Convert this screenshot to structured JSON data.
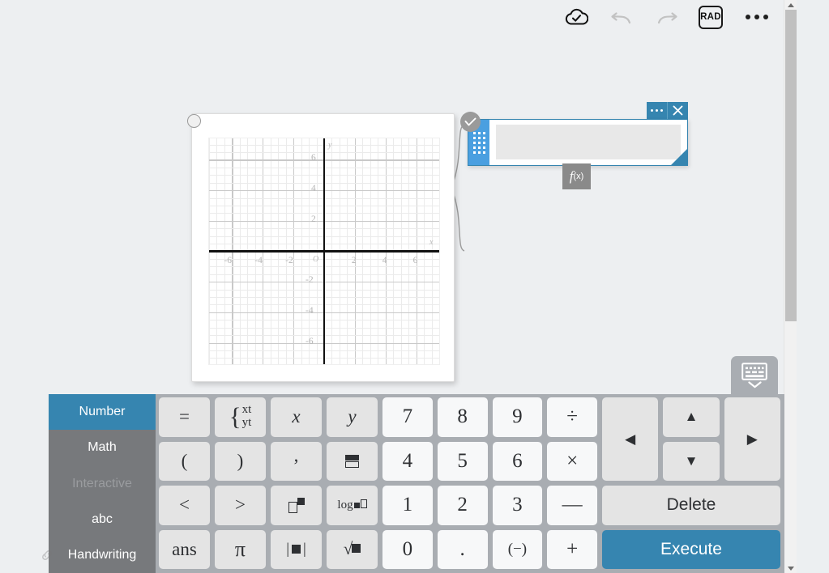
{
  "toolbar": {
    "cloud_label": "cloud-saved",
    "undo_label": "undo",
    "redo_label": "redo",
    "angle_mode": "RAD",
    "more_label": "more-options"
  },
  "graph": {
    "x_axis_name": "x",
    "y_axis_name": "y",
    "origin_label": "O",
    "x_ticks": [
      "-6",
      "-4",
      "-2",
      "2",
      "4",
      "6"
    ],
    "y_ticks": [
      "6",
      "4",
      "2",
      "-2",
      "-4",
      "-6"
    ]
  },
  "chart_data": {
    "type": "scatter",
    "title": "",
    "xlabel": "x",
    "ylabel": "y",
    "xlim": [
      -7.5,
      7.5
    ],
    "ylim": [
      -7.4,
      7.4
    ],
    "xticks": [
      -6,
      -4,
      -2,
      2,
      4,
      6
    ],
    "yticks": [
      6,
      4,
      2,
      -2,
      -4,
      -6
    ],
    "grid": true,
    "minor_grid_step": 0.5,
    "major_grid_step": 2,
    "legend": "none",
    "series": []
  },
  "input_panel": {
    "value": "",
    "placeholder": "",
    "confirm_label": "confirm",
    "more_label": "panel-menu",
    "close_label": "close",
    "grip_label": "drag-handle",
    "resize_label": "resize",
    "fx_label": "f",
    "fx_sub": "(x)"
  },
  "keyboard": {
    "toggle_label": "hide-keyboard",
    "tabs": [
      {
        "label": "Number",
        "state": "active"
      },
      {
        "label": "Math",
        "state": "normal"
      },
      {
        "label": "Interactive",
        "state": "disabled"
      },
      {
        "label": "abc",
        "state": "normal"
      },
      {
        "label": "Handwriting",
        "state": "normal"
      }
    ],
    "function_keys": [
      {
        "name": "equals",
        "label": "="
      },
      {
        "name": "piecewise",
        "label": ""
      },
      {
        "name": "variable-x",
        "label": "x"
      },
      {
        "name": "variable-y",
        "label": "y"
      },
      {
        "name": "paren-open",
        "label": "("
      },
      {
        "name": "paren-close",
        "label": ")"
      },
      {
        "name": "comma",
        "label": ","
      },
      {
        "name": "fraction",
        "label": ""
      },
      {
        "name": "less-than",
        "label": "<"
      },
      {
        "name": "greater-than",
        "label": ">"
      },
      {
        "name": "power",
        "label": ""
      },
      {
        "name": "logarithm",
        "label": "log"
      },
      {
        "name": "answer",
        "label": "ans"
      },
      {
        "name": "pi",
        "label": "π"
      },
      {
        "name": "absolute-value",
        "label": ""
      },
      {
        "name": "square-root",
        "label": ""
      }
    ],
    "piecewise_top": "xt",
    "piecewise_bottom": "yt",
    "number_keys": [
      "7",
      "8",
      "9",
      "÷",
      "4",
      "5",
      "6",
      "×",
      "1",
      "2",
      "3",
      "—",
      "0",
      ".",
      "(−)",
      "+"
    ],
    "action_keys": {
      "left": "◀",
      "up": "▲",
      "down": "▼",
      "right": "▶",
      "delete": "Delete",
      "execute": "Execute"
    }
  },
  "colors": {
    "accent_blue": "#3685b0",
    "grip_blue": "#4a9fe0",
    "keyboard_bg": "#a9adb2",
    "tab_bg": "#77797c",
    "key_bg": "#e4e4e4",
    "key_light_bg": "#f7f8f9"
  }
}
